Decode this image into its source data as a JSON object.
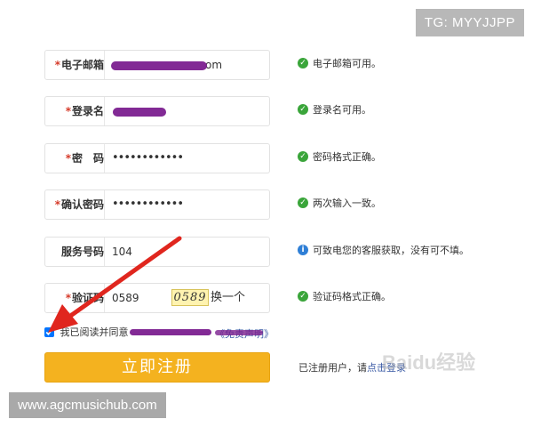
{
  "watermark_top": "TG: MYYJJPP",
  "watermark_bottom": "www.agcmusichub.com",
  "fields": [
    {
      "label": "电子邮箱",
      "required": true,
      "value": "om",
      "status": "电子邮箱可用。",
      "status_type": "ok"
    },
    {
      "label": "登录名",
      "required": true,
      "value": "",
      "status": "登录名可用。",
      "status_type": "ok"
    },
    {
      "label": "密　码",
      "required": true,
      "value": "••••••••••••",
      "status": "密码格式正确。",
      "status_type": "ok"
    },
    {
      "label": "确认密码",
      "required": true,
      "value": "••••••••••••",
      "status": "两次输入一致。",
      "status_type": "ok"
    },
    {
      "label": "服务号码",
      "required": false,
      "value": "104",
      "status": "可致电您的客服获取，没有可不填。",
      "status_type": "info"
    },
    {
      "label": "验证码",
      "required": true,
      "value": "0589",
      "status": "验证码格式正确。",
      "status_type": "ok"
    }
  ],
  "captcha": {
    "image_text": "0589",
    "refresh_label": "换一个"
  },
  "agreement": {
    "checked": true,
    "text": "我已阅读并同意",
    "link2": "《免责声明》"
  },
  "register_button": "立即注册",
  "login_hint": {
    "text": "已注册用户，请",
    "link": "点击登录"
  },
  "baidu_watermark": "Baidu经验",
  "colors": {
    "button": "#f4b21f",
    "ok_icon": "#3aa53a",
    "info_icon": "#2f7fd6",
    "required_star": "#d63b2a",
    "arrow": "#e0261e",
    "scribble": "#7b1f8f"
  }
}
